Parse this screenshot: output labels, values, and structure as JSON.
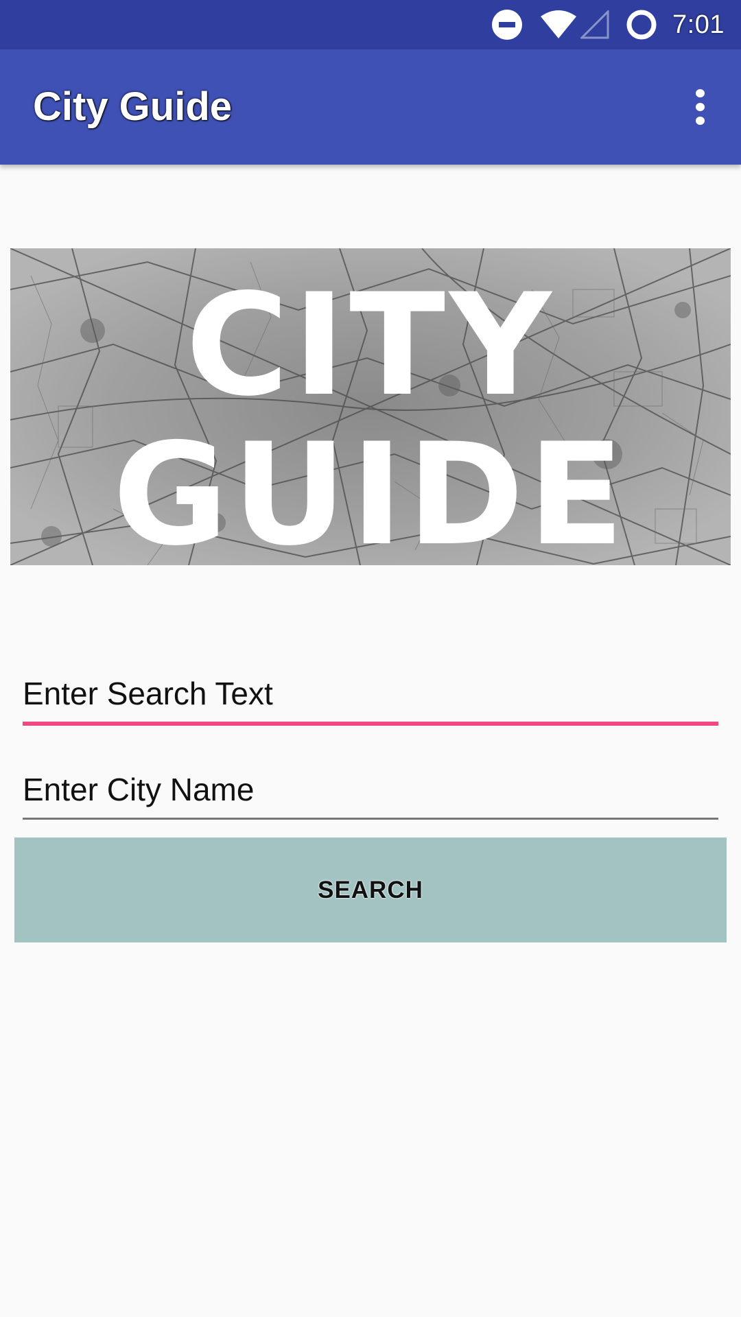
{
  "status_bar": {
    "time": "7:01",
    "icons": [
      "do-not-disturb-icon",
      "wifi-icon",
      "cell-signal-icon",
      "sync-circle-icon"
    ]
  },
  "app_bar": {
    "title": "City Guide",
    "menu_icon": "more-vert-icon"
  },
  "banner": {
    "line1": "CITY",
    "line2": "GUIDE"
  },
  "form": {
    "search_text": {
      "placeholder": "Enter Search Text",
      "value": ""
    },
    "city_name": {
      "placeholder": "Enter City Name",
      "value": ""
    },
    "search_button_label": "SEARCH"
  },
  "colors": {
    "status_bar": "#303f9f",
    "app_bar": "#3f51b5",
    "accent_underline": "#f0497d",
    "button_bg": "#a3c3c3",
    "background": "#fafafa"
  }
}
